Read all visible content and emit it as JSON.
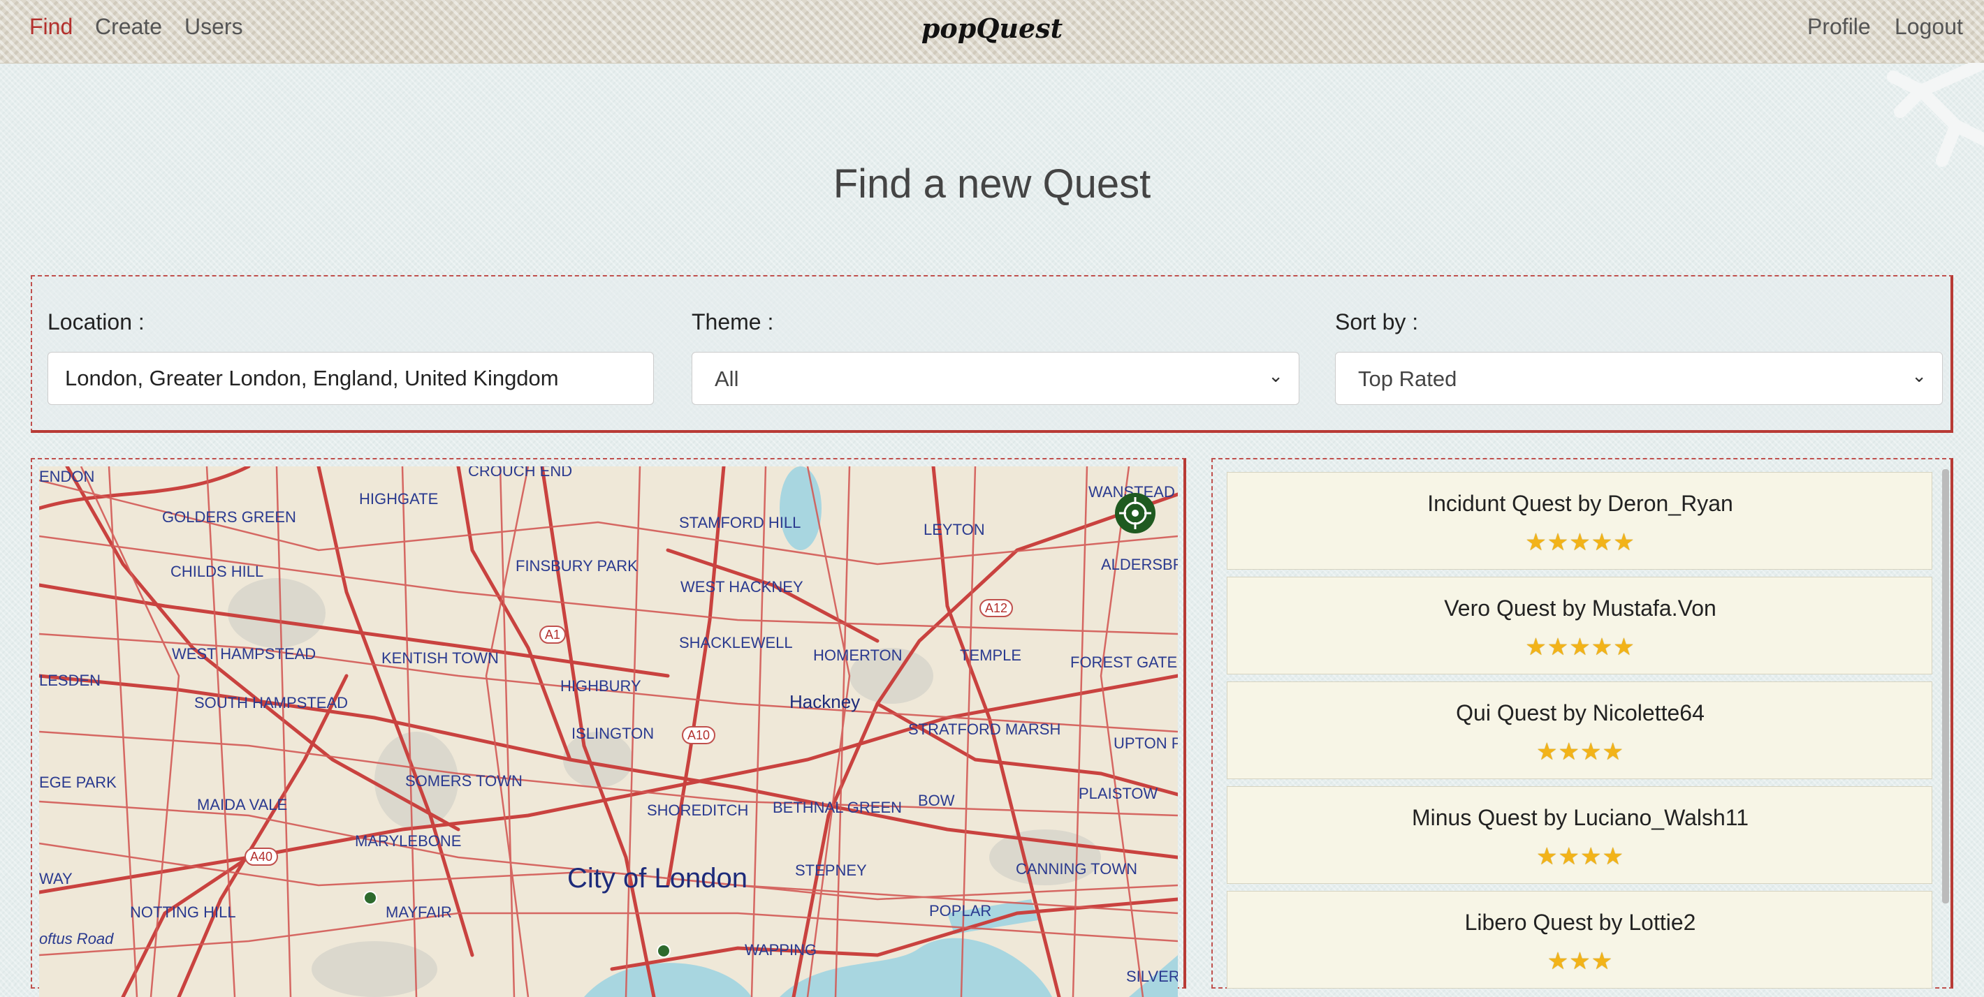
{
  "nav": {
    "find": "Find",
    "create": "Create",
    "users": "Users",
    "brand": "popQuest",
    "profile": "Profile",
    "logout": "Logout"
  },
  "page": {
    "title": "Find a new Quest"
  },
  "filters": {
    "location_label": "Location :",
    "location_value": "London, Greater London, England, United Kingdom",
    "theme_label": "Theme :",
    "theme_value": "All",
    "sort_label": "Sort by :",
    "sort_value": "Top Rated"
  },
  "map": {
    "labels": {
      "endon": "ENDON",
      "crouch_end": "CROUCH END",
      "highgate": "HIGHGATE",
      "golders_green": "GOLDERS GREEN",
      "stamford_hill": "STAMFORD HILL",
      "leyton": "LEYTON",
      "wanstead": "WANSTEAD",
      "childs_hill": "CHILDS HILL",
      "finsbury_park": "FINSBURY PARK",
      "west_hackney": "WEST HACKNEY",
      "aldersbro": "ALDERSBRO",
      "west_hampstead": "WEST HAMPSTEAD",
      "kentish_town": "KENTISH TOWN",
      "shacklewell": "SHACKLEWELL",
      "homerton": "HOMERTON",
      "temple": "TEMPLE",
      "forest_gate": "FOREST GATE",
      "lesden": "LESDEN",
      "south_hampstead": "SOUTH HAMPSTEAD",
      "highbury": "HIGHBURY",
      "hackney": "Hackney",
      "islington": "ISLINGTON",
      "stratford_marsh": "STRATFORD MARSH",
      "upton_pa": "UPTON PA",
      "ege_park": "EGE PARK",
      "somers_town": "SOMERS TOWN",
      "maida_vale": "MAIDA VALE",
      "shoreditch": "SHOREDITCH",
      "bethnal_green": "BETHNAL GREEN",
      "bow": "BOW",
      "plaistow": "PLAISTOW",
      "marylebone": "MARYLEBONE",
      "city_of_london": "City of London",
      "stepney": "STEPNEY",
      "canning_town": "CANNING TOWN",
      "way": "WAY",
      "notting_hill": "NOTTING HILL",
      "mayfair": "MAYFAIR",
      "poplar": "POPLAR",
      "loftus_road": "oftus Road",
      "wapping": "WAPPING",
      "silvert": "SILVERT"
    },
    "roads": {
      "a1": "A1",
      "a12": "A12",
      "a10": "A10",
      "a40": "A40"
    }
  },
  "quests": [
    {
      "title": "Incidunt Quest by Deron_Ryan",
      "stars": "★★★★★"
    },
    {
      "title": "Vero Quest by Mustafa.Von",
      "stars": "★★★★★"
    },
    {
      "title": "Qui Quest by Nicolette64",
      "stars": "★★★★"
    },
    {
      "title": "Minus Quest by Luciano_Walsh11",
      "stars": "★★★★"
    },
    {
      "title": "Libero Quest by Lottie2",
      "stars": "★★★"
    }
  ]
}
